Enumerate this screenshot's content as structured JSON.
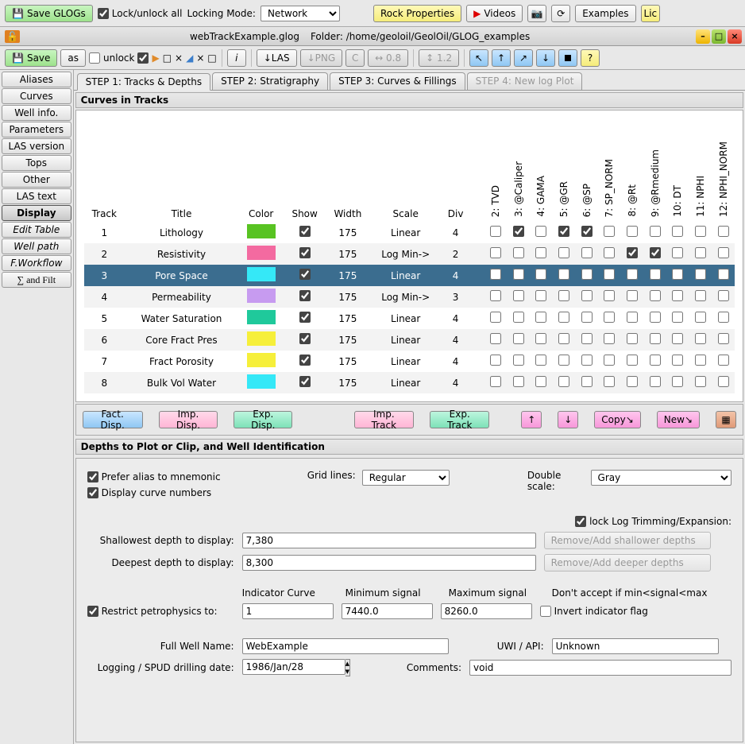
{
  "top": {
    "save_glogs": "Save GLOGs",
    "lock_all": "Lock/unlock all",
    "locking_mode_lbl": "Locking Mode:",
    "locking_mode_val": "Network",
    "rock": "Rock  Properties",
    "videos": "Videos",
    "examples": "Examples",
    "lic": "Lic"
  },
  "title": {
    "file": "webTrackExample.glog",
    "folder_lbl": "Folder: ",
    "folder": "/home/geoloil/GeolOil/GLOG_examples"
  },
  "tb2": {
    "save": "Save",
    "as": "as",
    "unlock": "unlock",
    "las_dn": "↓LAS",
    "png": "↓PNG",
    "c": "C",
    "w": "↔ 0.8",
    "h": "↕ 1.2",
    "info": "i",
    "q": "?"
  },
  "sidebar": [
    "Aliases",
    "Curves",
    "Well info.",
    "Parameters",
    "LAS version",
    "Tops",
    "Other",
    "LAS text",
    "Display",
    "Edit Table",
    "Well path",
    "F.Workflow",
    "∑ and Filt"
  ],
  "sidebar_active": 8,
  "sidebar_italic": [
    9,
    10,
    11
  ],
  "tabs": [
    {
      "label": "STEP 1: Tracks & Depths",
      "active": true
    },
    {
      "label": "STEP 2: Stratigraphy"
    },
    {
      "label": "STEP 3: Curves & Fillings"
    },
    {
      "label": "STEP 4: New log Plot",
      "disabled": true
    }
  ],
  "panel1_title": "Curves in Tracks",
  "cols_fixed": [
    "Track",
    "Title",
    "Color",
    "Show",
    "Width",
    "Scale",
    "Div"
  ],
  "cols_vert": [
    "2: TVD",
    "3: @Caliper",
    "4: GAMA",
    "5: @GR",
    "6: @SP",
    "7: SP_NORM",
    "8: @Rt",
    "9: @Rmedium",
    "10: DT",
    "11: NPHI",
    "12: NPHI_NORM"
  ],
  "rows": [
    {
      "track": "1",
      "title": "Lithology",
      "color": "#58c322",
      "show": true,
      "width": "175",
      "scale": "Linear",
      "div": "4",
      "checks": [
        false,
        true,
        false,
        true,
        true,
        false,
        false,
        false,
        false,
        false,
        false
      ]
    },
    {
      "track": "2",
      "title": "Resistivity",
      "color": "#f36aa0",
      "show": true,
      "width": "175",
      "scale": "Log Min->",
      "div": "2",
      "checks": [
        false,
        false,
        false,
        false,
        false,
        false,
        true,
        true,
        false,
        false,
        false
      ]
    },
    {
      "track": "3",
      "title": "Pore Space",
      "color": "#35e8f7",
      "show": true,
      "width": "175",
      "scale": "Linear",
      "div": "4",
      "checks": [
        false,
        false,
        false,
        false,
        false,
        false,
        false,
        false,
        false,
        false,
        false
      ],
      "selected": true
    },
    {
      "track": "4",
      "title": "Permeability",
      "color": "#c79bf0",
      "show": true,
      "width": "175",
      "scale": "Log Min->",
      "div": "3",
      "checks": [
        false,
        false,
        false,
        false,
        false,
        false,
        false,
        false,
        false,
        false,
        false
      ]
    },
    {
      "track": "5",
      "title": "Water Saturation",
      "color": "#1fc99b",
      "show": true,
      "width": "175",
      "scale": "Linear",
      "div": "4",
      "checks": [
        false,
        false,
        false,
        false,
        false,
        false,
        false,
        false,
        false,
        false,
        false
      ]
    },
    {
      "track": "6",
      "title": "Core Fract Pres",
      "color": "#f6ef3a",
      "show": true,
      "width": "175",
      "scale": "Linear",
      "div": "4",
      "checks": [
        false,
        false,
        false,
        false,
        false,
        false,
        false,
        false,
        false,
        false,
        false
      ]
    },
    {
      "track": "7",
      "title": "Fract Porosity",
      "color": "#f6ef3a",
      "show": true,
      "width": "175",
      "scale": "Linear",
      "div": "4",
      "checks": [
        false,
        false,
        false,
        false,
        false,
        false,
        false,
        false,
        false,
        false,
        false
      ]
    },
    {
      "track": "8",
      "title": "Bulk Vol Water",
      "color": "#35e8f7",
      "show": true,
      "width": "175",
      "scale": "Linear",
      "div": "4",
      "checks": [
        false,
        false,
        false,
        false,
        false,
        false,
        false,
        false,
        false,
        false,
        false
      ]
    }
  ],
  "btnbar": {
    "fact": "Fact. Disp.",
    "imp_d": "Imp. Disp.",
    "exp_d": "Exp. Disp.",
    "imp_t": "Imp. Track",
    "exp_t": "Exp. Track",
    "up": "↑",
    "down": "↓",
    "copy": "Copy↘",
    "new": "New↘"
  },
  "panel2_title": "Depths to Plot or Clip, and Well Identification",
  "depths": {
    "prefer_alias": "Prefer alias to mnemonic",
    "display_nums": "Display curve numbers",
    "grid_lbl": "Grid lines:",
    "grid_val": "Regular",
    "dbl_lbl": "Double scale:",
    "dbl_val": "Gray",
    "lock_trim": "lock Log Trimming/Expansion:",
    "shallow_lbl": "Shallowest depth to display:",
    "shallow": "7,380",
    "deep_lbl": "Deepest depth to display:",
    "deep": "8,300",
    "rem_sh": "Remove/Add shallower depths",
    "rem_dp": "Remove/Add deeper depths",
    "restrict": "Restrict petrophysics to:",
    "ind_lbl": "Indicator Curve",
    "ind": "1",
    "min_lbl": "Minimum signal",
    "min": "7440.0",
    "max_lbl": "Maximum signal",
    "max": "8260.0",
    "reject": "Don't accept if min<signal<max",
    "invert": "Invert indicator flag",
    "well_lbl": "Full Well Name:",
    "well": "WebExample",
    "uwi_lbl": "UWI / API:",
    "uwi": "Unknown",
    "date_lbl": "Logging / SPUD drilling date:",
    "date": "1986/Jan/28",
    "comm_lbl": "Comments:",
    "comm": "void"
  }
}
